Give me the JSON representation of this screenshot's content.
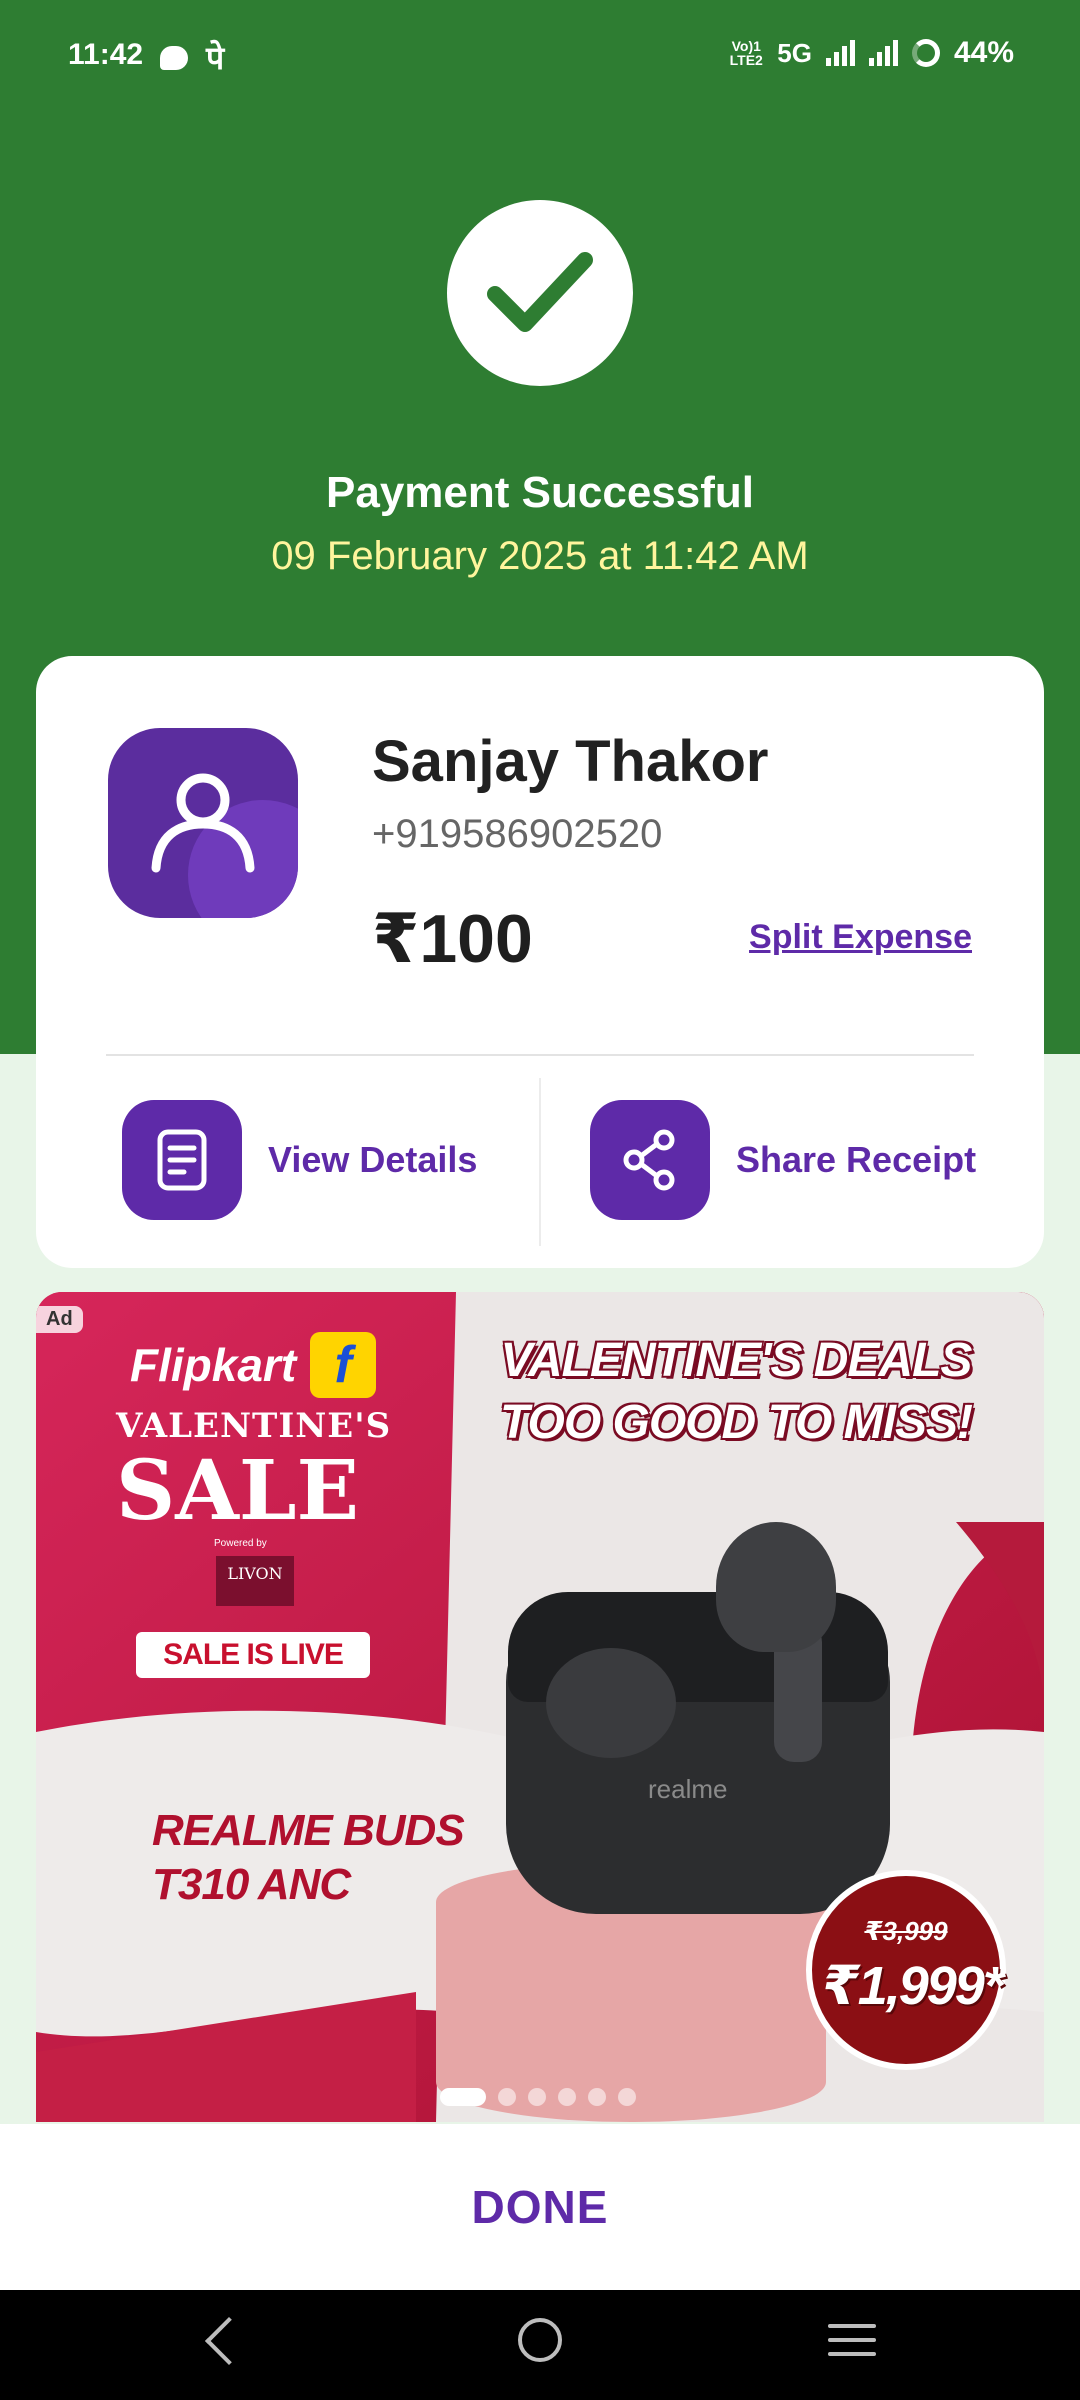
{
  "status_bar": {
    "time": "11:42",
    "pe_glyph": "पे",
    "volte": "Vo)1 LTE2",
    "network": "5G",
    "battery": "44%"
  },
  "header": {
    "title": "Payment Successful",
    "datetime": "09 February 2025 at 11:42 AM",
    "icon": "check-icon"
  },
  "payment": {
    "payee_name": "Sanjay Thakor",
    "payee_phone": "+919586902520",
    "amount": "₹100",
    "split_label": "Split Expense"
  },
  "actions": {
    "view_details": "View Details",
    "share_receipt": "Share Receipt"
  },
  "ad": {
    "tag": "Ad",
    "brand": "Flipkart",
    "sale_line1": "VALENTINE'S",
    "sale_line2": "SALE",
    "powered_by": "Powered by",
    "sponsor": "LIVON",
    "sale_live": "SALE IS LIVE",
    "headline_1": "VALENTINE'S DEALS",
    "headline_2": "TOO GOOD TO MISS!",
    "product_line1": "REALME BUDS",
    "product_line2": "T310 ANC",
    "case_logo": "realme",
    "old_price": "₹3,999",
    "new_price": "₹1,999*",
    "carousel_total": 6,
    "carousel_active": 1
  },
  "footer": {
    "done_label": "DONE"
  },
  "colors": {
    "header_green": "#2e7d32",
    "accent_purple": "#5e2aa8",
    "date_yellow": "#fff59d"
  }
}
